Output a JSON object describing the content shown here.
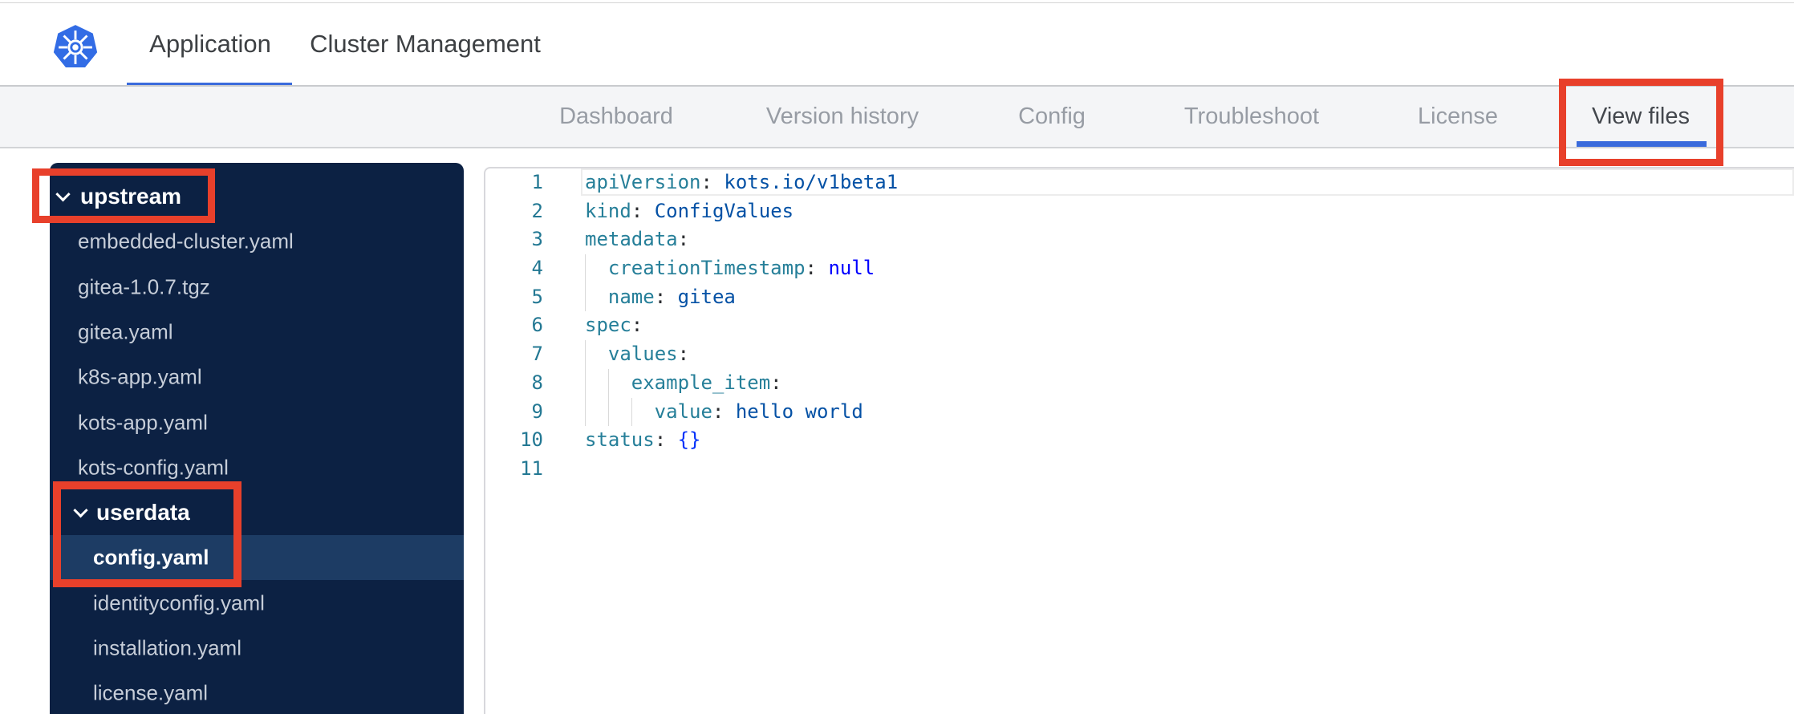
{
  "colors": {
    "accent_blue": "#3a6bdc",
    "kubernetes_blue": "#326ce5",
    "annotation_red": "#e8402b",
    "sidebar_bg": "#0c2143",
    "sidebar_selected_bg": "#1d3c64",
    "sidebar_file_text": "#c6cdd8",
    "tabbar_bg": "#f4f5f7",
    "tab_text": "#979ca4",
    "tab_text_active": "#43474d",
    "code_key": "#267f99",
    "code_string": "#0451a5",
    "code_keyword": "#0000ff",
    "code_bracket": "#0431fa",
    "code_line_number": "#237893"
  },
  "header": {
    "tabs": [
      {
        "label": "Application",
        "active": true
      },
      {
        "label": "Cluster Management",
        "active": false
      }
    ]
  },
  "nav": {
    "tabs": [
      {
        "label": "Dashboard",
        "active": false
      },
      {
        "label": "Version history",
        "active": false
      },
      {
        "label": "Config",
        "active": false
      },
      {
        "label": "Troubleshoot",
        "active": false
      },
      {
        "label": "License",
        "active": false
      },
      {
        "label": "View files",
        "active": true
      }
    ]
  },
  "file_tree": {
    "items": [
      {
        "label": "upstream",
        "type": "folder",
        "expanded": true,
        "level": 0,
        "selected": false,
        "annotated": true
      },
      {
        "label": "embedded-cluster.yaml",
        "type": "file",
        "level": 1,
        "selected": false,
        "annotated": false
      },
      {
        "label": "gitea-1.0.7.tgz",
        "type": "file",
        "level": 1,
        "selected": false,
        "annotated": false
      },
      {
        "label": "gitea.yaml",
        "type": "file",
        "level": 1,
        "selected": false,
        "annotated": false
      },
      {
        "label": "k8s-app.yaml",
        "type": "file",
        "level": 1,
        "selected": false,
        "annotated": false
      },
      {
        "label": "kots-app.yaml",
        "type": "file",
        "level": 1,
        "selected": false,
        "annotated": false
      },
      {
        "label": "kots-config.yaml",
        "type": "file",
        "level": 1,
        "selected": false,
        "annotated": false
      },
      {
        "label": "userdata",
        "type": "folder",
        "expanded": true,
        "level": 1,
        "selected": false,
        "annotated": true
      },
      {
        "label": "config.yaml",
        "type": "file",
        "level": 2,
        "selected": true,
        "annotated": true
      },
      {
        "label": "identityconfig.yaml",
        "type": "file",
        "level": 2,
        "selected": false,
        "annotated": false
      },
      {
        "label": "installation.yaml",
        "type": "file",
        "level": 2,
        "selected": false,
        "annotated": false
      },
      {
        "label": "license.yaml",
        "type": "file",
        "level": 2,
        "selected": false,
        "annotated": false
      }
    ]
  },
  "editor": {
    "language": "yaml",
    "selected_file": "config.yaml",
    "lines": [
      {
        "number": 1,
        "indent": 0,
        "current": true,
        "tokens": [
          [
            "key",
            "apiVersion"
          ],
          [
            "punct",
            ": "
          ],
          [
            "str",
            "kots.io/v1beta1"
          ]
        ]
      },
      {
        "number": 2,
        "indent": 0,
        "current": false,
        "tokens": [
          [
            "key",
            "kind"
          ],
          [
            "punct",
            ": "
          ],
          [
            "str",
            "ConfigValues"
          ]
        ]
      },
      {
        "number": 3,
        "indent": 0,
        "current": false,
        "tokens": [
          [
            "key",
            "metadata"
          ],
          [
            "punct",
            ":"
          ]
        ]
      },
      {
        "number": 4,
        "indent": 1,
        "current": false,
        "tokens": [
          [
            "key",
            "creationTimestamp"
          ],
          [
            "punct",
            ": "
          ],
          [
            "kw",
            "null"
          ]
        ]
      },
      {
        "number": 5,
        "indent": 1,
        "current": false,
        "tokens": [
          [
            "key",
            "name"
          ],
          [
            "punct",
            ": "
          ],
          [
            "str",
            "gitea"
          ]
        ]
      },
      {
        "number": 6,
        "indent": 0,
        "current": false,
        "tokens": [
          [
            "key",
            "spec"
          ],
          [
            "punct",
            ":"
          ]
        ]
      },
      {
        "number": 7,
        "indent": 1,
        "current": false,
        "tokens": [
          [
            "key",
            "values"
          ],
          [
            "punct",
            ":"
          ]
        ]
      },
      {
        "number": 8,
        "indent": 2,
        "current": false,
        "tokens": [
          [
            "key",
            "example_item"
          ],
          [
            "punct",
            ":"
          ]
        ]
      },
      {
        "number": 9,
        "indent": 3,
        "current": false,
        "tokens": [
          [
            "key",
            "value"
          ],
          [
            "punct",
            ": "
          ],
          [
            "str",
            "hello world"
          ]
        ]
      },
      {
        "number": 10,
        "indent": 0,
        "current": false,
        "tokens": [
          [
            "key",
            "status"
          ],
          [
            "punct",
            ": "
          ],
          [
            "bracket",
            "{}"
          ]
        ]
      },
      {
        "number": 11,
        "indent": 0,
        "current": false,
        "tokens": []
      }
    ]
  },
  "annotations": {
    "boxes": [
      "upstream-folder",
      "userdata-and-config",
      "view-files-tab"
    ]
  }
}
